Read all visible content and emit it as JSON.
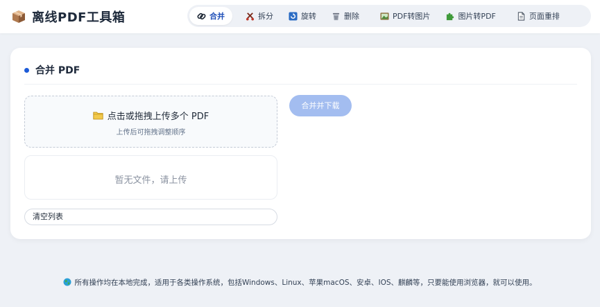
{
  "app": {
    "title": "离线PDF工具箱"
  },
  "nav": {
    "items": [
      {
        "label": "合并",
        "icon": "link-icon",
        "active": true
      },
      {
        "label": "拆分",
        "icon": "scissors-icon",
        "active": false
      },
      {
        "label": "旋转",
        "icon": "rotate-icon",
        "active": false
      },
      {
        "label": "删除",
        "icon": "trash-icon",
        "active": false
      },
      {
        "label": "PDF转图片",
        "icon": "picture-icon",
        "active": false
      },
      {
        "label": "图片转PDF",
        "icon": "puzzle-icon",
        "active": false
      },
      {
        "label": "页面重排",
        "icon": "page-icon",
        "active": false
      }
    ]
  },
  "merge": {
    "title": "合并 PDF",
    "dropzone_title": "点击或拖拽上传多个 PDF",
    "dropzone_hint": "上传后可拖拽调整顺序",
    "empty_text": "暂无文件，请上传",
    "clear_label": "清空列表",
    "merge_download_label": "合并并下载"
  },
  "footer": {
    "text": "所有操作均在本地完成，适用于各类操作系统，包括Windows、Linux、苹果macOS、安卓、IOS、麒麟等，只要能使用浏览器，就可以使用。"
  },
  "colors": {
    "accent": "#1d5bd8",
    "button_disabled": "#a3bdf0",
    "background": "#eef1f6"
  }
}
